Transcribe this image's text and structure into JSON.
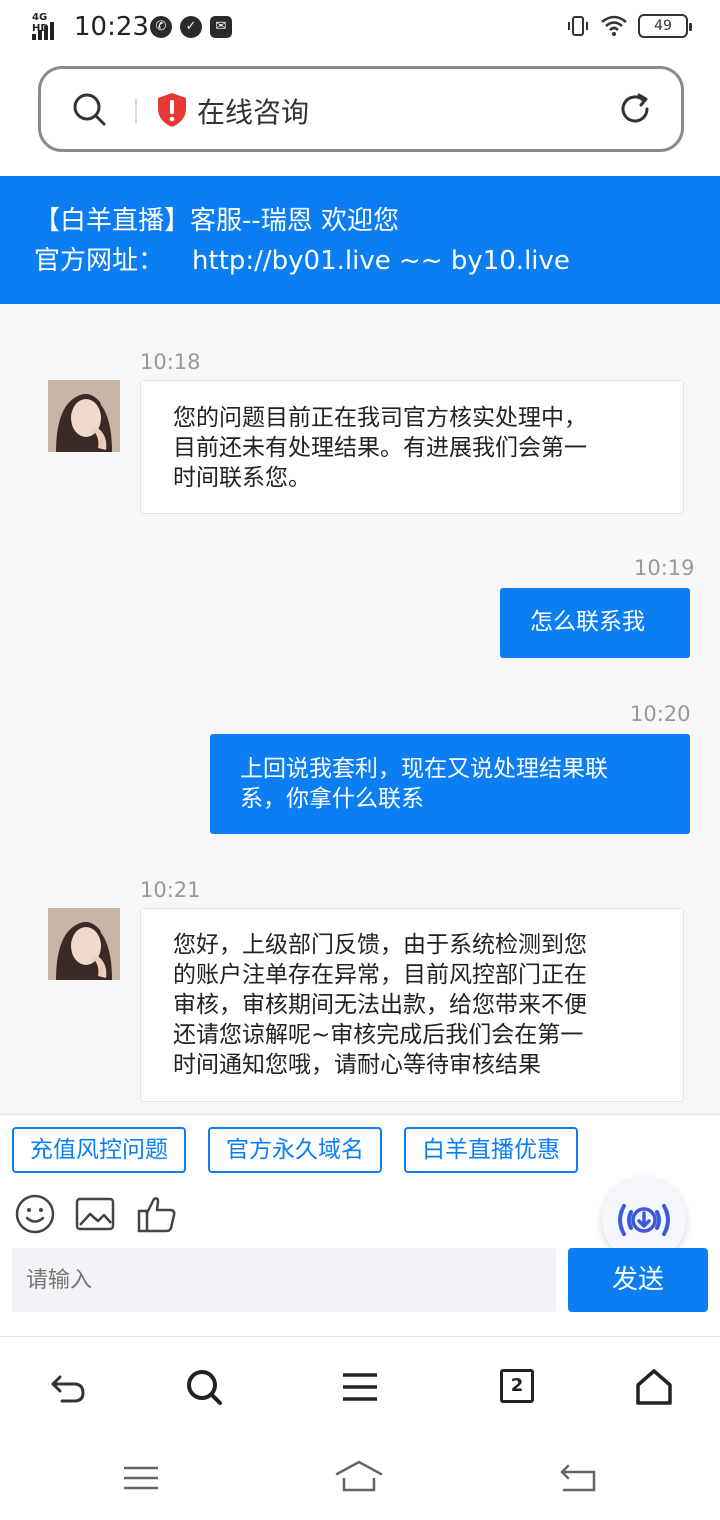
{
  "status_bar": {
    "network": "4G HD",
    "time": "10:23",
    "battery": "49"
  },
  "address_bar": {
    "title": "在线咨询"
  },
  "banner": {
    "line1": "【白羊直播】客服--瑞恩 欢迎您",
    "line2_label": "官方网址：",
    "line2_url": "http://by01.live ~~ by10.live"
  },
  "messages": [
    {
      "time": "10:18",
      "direction": "in",
      "lines": [
        "您的问题目前正在我司官方核实处理中，",
        "目前还未有处理结果。有进展我们会第一",
        "时间联系您。"
      ]
    },
    {
      "time": "10:19",
      "direction": "out",
      "lines": [
        "怎么联系我"
      ]
    },
    {
      "time": "10:20",
      "direction": "out",
      "lines": [
        "上回说我套利，现在又说处理结果联",
        "系，你拿什么联系"
      ]
    },
    {
      "time": "10:21",
      "direction": "in",
      "lines": [
        "您好，上级部门反馈，由于系统检测到您",
        "的账户注单存在异常，目前风控部门正在",
        "审核，审核期间无法出款，给您带来不便",
        "还请您谅解呢~审核完成后我们会在第一",
        "时间通知您哦，请耐心等待审核结果"
      ]
    }
  ],
  "quick_replies": [
    "充值风控问题",
    "官方永久域名",
    "白羊直播优惠"
  ],
  "composer": {
    "placeholder": "请输入",
    "send_label": "发送"
  },
  "browser_bar": {
    "tab_count": "2"
  },
  "colors": {
    "accent": "#0a7ef2",
    "chat_bg": "#f7f7f8"
  }
}
